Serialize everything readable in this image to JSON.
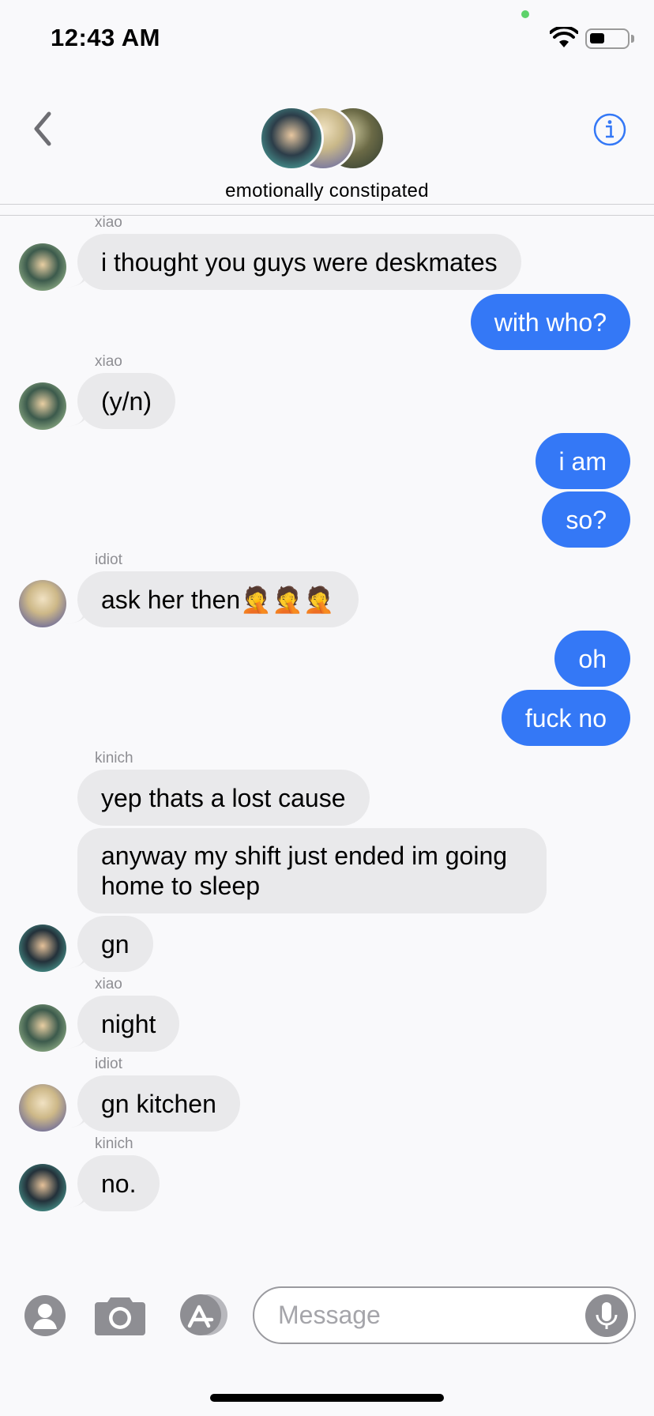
{
  "status": {
    "time": "12:43 AM"
  },
  "header": {
    "group_name": "emotionally constipated"
  },
  "messages": {
    "m1": {
      "sender": "xiao",
      "text": "i thought you guys were deskmates"
    },
    "m2": {
      "text": "with who?"
    },
    "m3": {
      "sender": "xiao",
      "text": "(y/n)"
    },
    "m4": {
      "text": "i am"
    },
    "m5": {
      "text": "so?"
    },
    "m6": {
      "sender": "idiot",
      "text": "ask her then🤦🤦🤦"
    },
    "m7": {
      "text": "oh"
    },
    "m8": {
      "text": "fuck no"
    },
    "m9": {
      "sender": "kinich",
      "text": "yep thats a lost cause"
    },
    "m10": {
      "text": "anyway my shift just ended im going home to sleep"
    },
    "m11": {
      "text": "gn"
    },
    "m12": {
      "sender": "xiao",
      "text": "night"
    },
    "m13": {
      "sender": "idiot",
      "text": "gn kitchen"
    },
    "m14": {
      "sender": "kinich",
      "text": "no."
    }
  },
  "composer": {
    "placeholder": "Message"
  },
  "colors": {
    "outgoing": "#3478f6",
    "incoming": "#e9e9eb",
    "accent": "#3478f6"
  },
  "icons": [
    "back-chevron-icon",
    "info-icon",
    "contact-icon",
    "camera-icon",
    "app-store-icon",
    "microphone-icon",
    "wifi-icon",
    "battery-icon"
  ]
}
